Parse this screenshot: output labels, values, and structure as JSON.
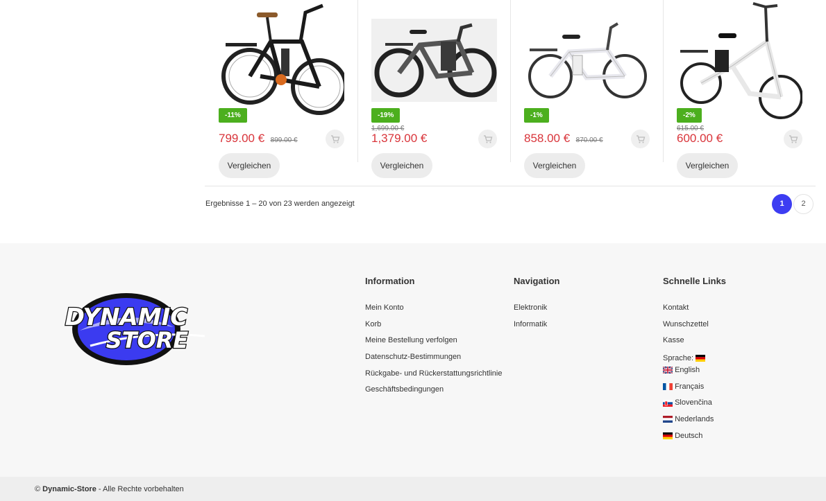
{
  "products": [
    {
      "discount": "-11%",
      "price": "799.00 €",
      "old_price": "899.00 €",
      "old_pos": "inline",
      "compare_label": "Vergleichen",
      "image": "black-city-ebike"
    },
    {
      "discount": "-19%",
      "price": "1,379.00 €",
      "old_price": "1,699.00 €",
      "old_pos": "top",
      "compare_label": "Vergleichen",
      "image": "grey-trekking-ebike"
    },
    {
      "discount": "-1%",
      "price": "858.00 €",
      "old_price": "870.00 €",
      "old_pos": "inline",
      "compare_label": "Vergleichen",
      "image": "white-city-ebike"
    },
    {
      "discount": "-2%",
      "price": "600.00 €",
      "old_price": "615.00 €",
      "old_pos": "top",
      "compare_label": "Vergleichen",
      "image": "white-folding-ebike"
    }
  ],
  "results": {
    "text": "Ergebnisse 1 – 20 von 23 werden angezeigt"
  },
  "pagination": {
    "current": "1",
    "next": "2"
  },
  "footer": {
    "logo": {
      "line1": "DYNAMIC",
      "line2": "STORE"
    },
    "information": {
      "title": "Information",
      "links": [
        "Mein Konto",
        "Korb",
        "Meine Bestellung verfolgen",
        "Datenschutz-Bestimmungen",
        "Rückgabe- und Rückerstattungsrichtlinie",
        "Geschäftsbedingungen"
      ]
    },
    "navigation": {
      "title": "Navigation",
      "links": [
        "Elektronik",
        "Informatik"
      ]
    },
    "quick_links": {
      "title": "Schnelle Links",
      "links": [
        "Kontakt",
        "Wunschzettel",
        "Kasse"
      ],
      "language_label": "Sprache:",
      "languages": [
        "English",
        "Français",
        "Slovenčina",
        "Nederlands",
        "Deutsch"
      ]
    }
  },
  "copyright": {
    "symbol": "©",
    "brand": "Dynamic-Store",
    "text": "- Alle Rechte vorbehalten"
  },
  "colors": {
    "accent": "#3d3df2",
    "price": "#d9343a",
    "badge": "#4caf1e",
    "footer_bg": "#f7f7f7"
  }
}
